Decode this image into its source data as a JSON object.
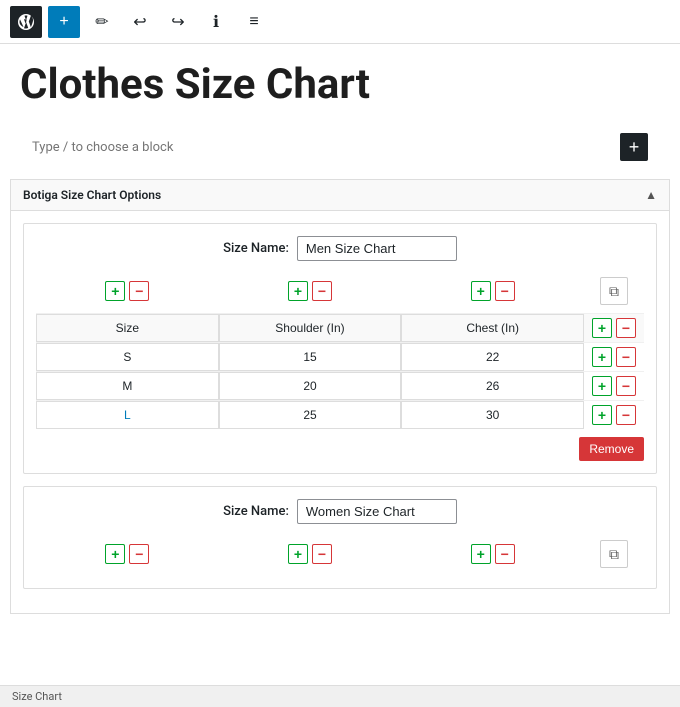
{
  "toolbar": {
    "add_label": "+",
    "undo_icon": "↩",
    "redo_icon": "↪",
    "info_icon": "ℹ",
    "list_icon": "≡",
    "pen_icon": "✏"
  },
  "page": {
    "title": "Clothes Size Chart"
  },
  "block_placeholder": {
    "text": "Type / to choose a block"
  },
  "panel": {
    "title": "Botiga Size Chart Options",
    "collapse_icon": "▲"
  },
  "charts": [
    {
      "id": "chart1",
      "size_name_label": "Size Name:",
      "size_name_value": "Men Size Chart",
      "columns": [
        "Size",
        "Shoulder (In)",
        "Chest (In)"
      ],
      "rows": [
        [
          "S",
          "15",
          "22"
        ],
        [
          "M",
          "20",
          "26"
        ],
        [
          "L",
          "25",
          "30"
        ]
      ],
      "remove_label": "Remove"
    },
    {
      "id": "chart2",
      "size_name_label": "Size Name:",
      "size_name_value": "Women Size Chart",
      "columns": [],
      "rows": []
    }
  ],
  "status_bar": {
    "text": "Size Chart"
  }
}
